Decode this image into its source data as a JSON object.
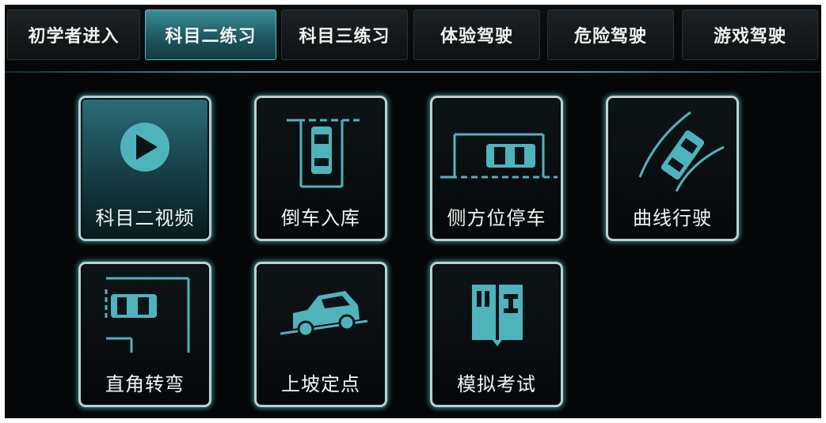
{
  "tabs": [
    {
      "label": "初学者进入",
      "active": false
    },
    {
      "label": "科目二练习",
      "active": true
    },
    {
      "label": "科目三练习",
      "active": false
    },
    {
      "label": "体验驾驶",
      "active": false
    },
    {
      "label": "危险驾驶",
      "active": false
    },
    {
      "label": "游戏驾驶",
      "active": false
    }
  ],
  "tiles": [
    {
      "label": "科目二视频",
      "icon": "play-icon",
      "active": true
    },
    {
      "label": "倒车入库",
      "icon": "reverse-parking-icon",
      "active": false
    },
    {
      "label": "侧方位停车",
      "icon": "parallel-parking-icon",
      "active": false
    },
    {
      "label": "曲线行驶",
      "icon": "curve-driving-icon",
      "active": false
    },
    {
      "label": "直角转弯",
      "icon": "right-angle-turn-icon",
      "active": false
    },
    {
      "label": "上坡定点",
      "icon": "hill-start-icon",
      "active": false
    },
    {
      "label": "模拟考试",
      "icon": "mock-exam-icon",
      "active": false
    }
  ],
  "colors": {
    "accent": "#3ea0aa",
    "icon": "#4fb3bc",
    "background": "#050607"
  }
}
